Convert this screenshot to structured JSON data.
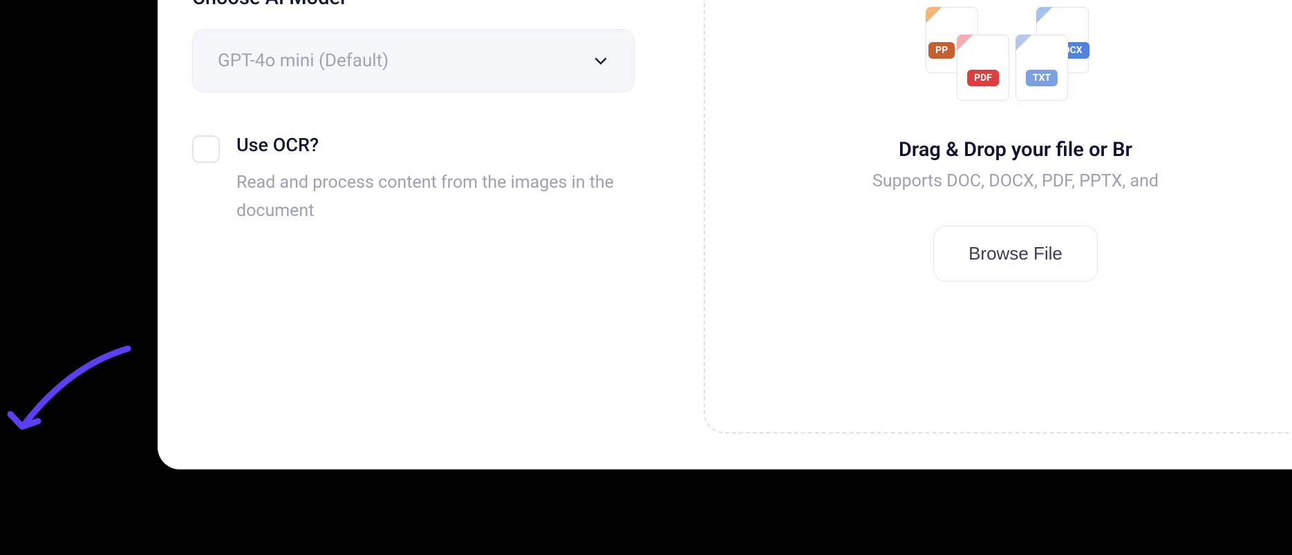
{
  "form": {
    "model_section_label": "Choose AI Model",
    "model_dropdown_value": "GPT-4o mini (Default)",
    "ocr": {
      "label": "Use OCR?",
      "description": "Read and process content from the images in the document"
    }
  },
  "upload": {
    "title_partial": "Drag & Drop your file or Br",
    "subtitle_partial": "Supports DOC, DOCX, PDF, PPTX, and",
    "browse_button": "Browse File",
    "badges": {
      "pp": "PP",
      "docx": "OCX",
      "pdf": "PDF",
      "txt": "TXT"
    }
  }
}
